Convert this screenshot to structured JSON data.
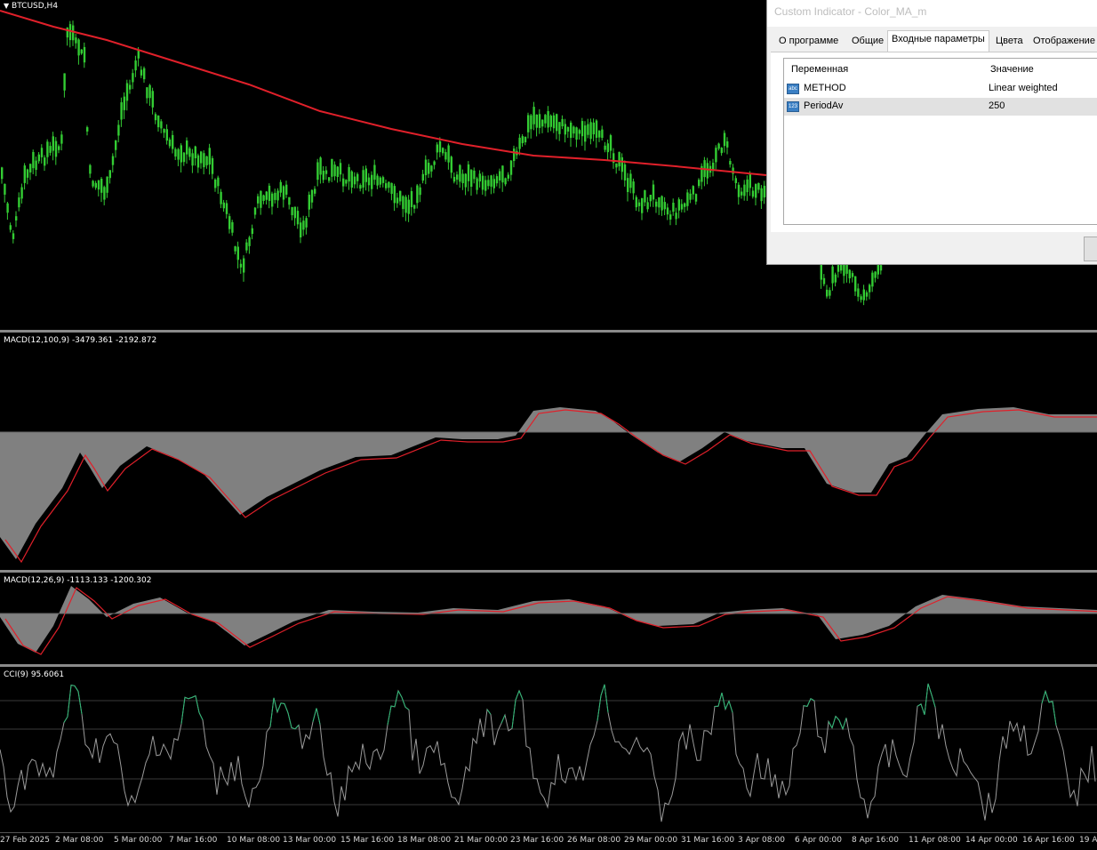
{
  "chart": {
    "symbol_label": "BTCUSD,H4",
    "macd_slow_label": "MACD(12,100,9) -3479.361 -2192.872",
    "macd_fast_label": "MACD(12,26,9) -1113.133 -1200.302",
    "cci_label": "CCI(9) 95.6061",
    "colors": {
      "bull_candle": "#33cc33",
      "ma_line": "#e0202a",
      "histogram": "#808080",
      "signal_line": "#e0202a",
      "cci_line": "#9a9a9a",
      "cci_highlight": "#2bb673"
    },
    "time_axis": [
      "27 Feb 2025",
      "2 Mar 08:00",
      "5 Mar 00:00",
      "7 Mar 16:00",
      "10 Mar 08:00",
      "13 Mar 00:00",
      "15 Mar 16:00",
      "18 Mar 08:00",
      "21 Mar 00:00",
      "23 Mar 16:00",
      "26 Mar 08:00",
      "29 Mar 00:00",
      "31 Mar 16:00",
      "3 Apr 08:00",
      "6 Apr 00:00",
      "8 Apr 16:00",
      "11 Apr 08:00",
      "14 Apr 00:00",
      "16 Apr 16:00",
      "19 A"
    ]
  },
  "dialog": {
    "title": "Custom Indicator - Color_MA_m",
    "tabs": [
      "О программе",
      "Общие",
      "Входные параметры",
      "Цвета",
      "Отображение"
    ],
    "active_tab": "Входные параметры",
    "columns": {
      "variable": "Переменная",
      "value": "Значение"
    },
    "params": [
      {
        "name": "METHOD",
        "value": "Linear weighted",
        "icon": "enum-icon"
      },
      {
        "name": "PeriodAv",
        "value": "250",
        "icon": "int-icon"
      }
    ]
  }
}
